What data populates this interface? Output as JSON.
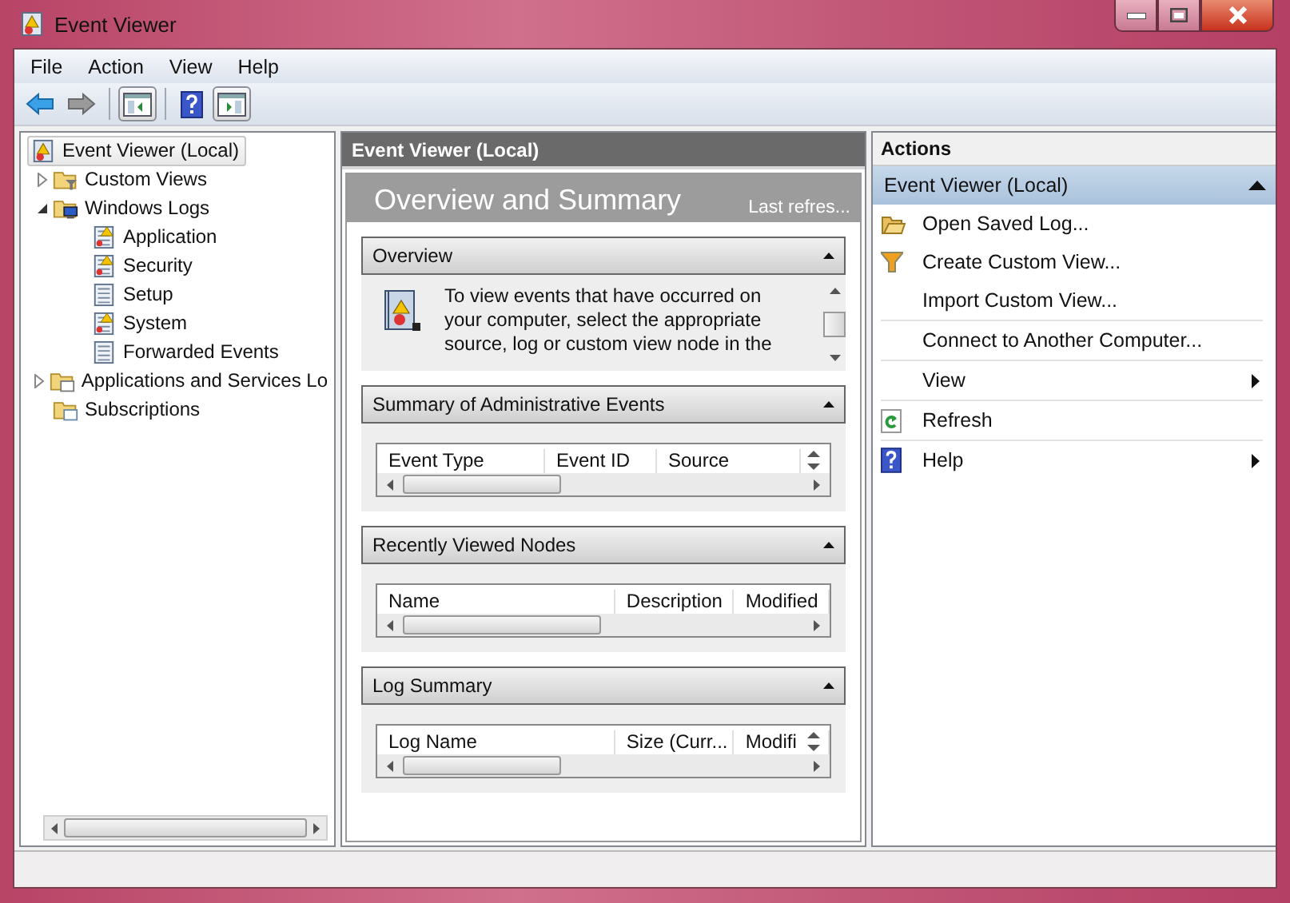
{
  "window": {
    "title": "Event Viewer"
  },
  "menu": [
    "File",
    "Action",
    "View",
    "Help"
  ],
  "tree": [
    {
      "label": "Event Viewer (Local)",
      "kind": "root",
      "selected": true,
      "children": [
        {
          "label": "Custom Views",
          "kind": "filterfolder",
          "selected": false,
          "expanded": false
        },
        {
          "label": "Windows Logs",
          "kind": "pcfolder",
          "selected": false,
          "expanded": true,
          "children": [
            {
              "label": "Application",
              "kind": "alertlog",
              "selected": false
            },
            {
              "label": "Security",
              "kind": "alertlog",
              "selected": false
            },
            {
              "label": "Setup",
              "kind": "log",
              "selected": false
            },
            {
              "label": "System",
              "kind": "alertlog",
              "selected": false
            },
            {
              "label": "Forwarded Events",
              "kind": "log",
              "selected": false
            }
          ]
        },
        {
          "label": "Applications and Services Lo",
          "kind": "folder",
          "selected": false,
          "expanded": false
        },
        {
          "label": "Subscriptions",
          "kind": "subfolder",
          "selected": false
        }
      ]
    }
  ],
  "center": {
    "header": "Event Viewer (Local)",
    "banner_title": "Overview and Summary",
    "banner_note": "Last refres...",
    "sections": [
      {
        "title": "Overview",
        "expanded": true,
        "kind": "text",
        "text": "To view events that have occurred on your computer, select the appropriate source, log or custom view node in the"
      },
      {
        "title": "Summary of Administrative Events",
        "expanded": true,
        "kind": "table",
        "spinner": true,
        "columns": [
          "Event Type",
          "Event ID",
          "Source"
        ]
      },
      {
        "title": "Recently Viewed Nodes",
        "expanded": true,
        "kind": "table",
        "spinner": false,
        "columns": [
          "Name",
          "Description",
          "Modified"
        ]
      },
      {
        "title": "Log Summary",
        "expanded": true,
        "kind": "table",
        "spinner": true,
        "columns": [
          "Log Name",
          "Size (Curr...",
          "Modifi"
        ]
      }
    ]
  },
  "actions": {
    "title": "Actions",
    "group": {
      "title": "Event Viewer (Local)",
      "expanded": true
    },
    "items": [
      {
        "label": "Open Saved Log...",
        "kind": "open",
        "submenu": false
      },
      {
        "label": "Create Custom View...",
        "kind": "filter",
        "submenu": false
      },
      {
        "label": "Import Custom View...",
        "kind": "plain",
        "submenu": false
      },
      {
        "label": "Connect to Another Computer...",
        "kind": "plain",
        "submenu": false
      },
      {
        "label": "View",
        "kind": "plain",
        "submenu": true
      },
      {
        "label": "Refresh",
        "kind": "refresh",
        "submenu": false
      },
      {
        "label": "Help",
        "kind": "help",
        "submenu": true
      }
    ]
  }
}
